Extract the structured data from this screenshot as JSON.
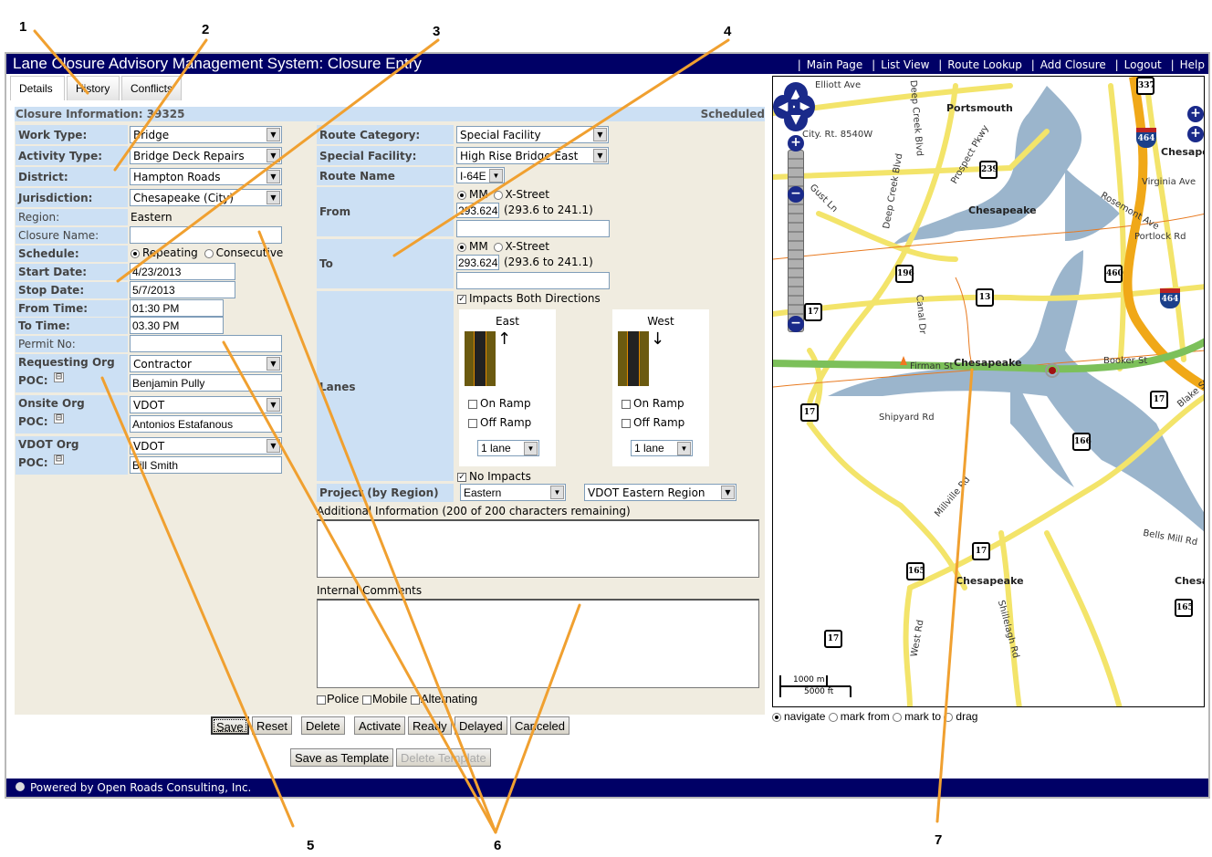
{
  "app": {
    "title": "Lane Closure Advisory Management System: Closure Entry",
    "nav": [
      "Main Page",
      "List View",
      "Route Lookup",
      "Add Closure",
      "Logout",
      "Help"
    ]
  },
  "tabs": [
    {
      "label": "Details",
      "active": true
    },
    {
      "label": "History",
      "active": false
    },
    {
      "label": "Conflicts",
      "active": false
    }
  ],
  "info": {
    "label": "Closure Information: 39325",
    "status": "Scheduled"
  },
  "left_form": {
    "work_type": {
      "label": "Work Type:",
      "value": "Bridge"
    },
    "activity_type": {
      "label": "Activity Type:",
      "value": "Bridge Deck Repairs"
    },
    "district": {
      "label": "District:",
      "value": "Hampton Roads"
    },
    "jurisdiction": {
      "label": "Jurisdiction:",
      "value": "Chesapeake (City)"
    },
    "region": {
      "label": "Region:",
      "value": "Eastern"
    },
    "closure_name": {
      "label": "Closure Name:",
      "value": ""
    },
    "schedule": {
      "label": "Schedule:",
      "options": [
        "Repeating",
        "Consecutive"
      ],
      "selected": "Repeating"
    },
    "start_date": {
      "label": "Start Date:",
      "value": "4/23/2013"
    },
    "stop_date": {
      "label": "Stop Date:",
      "value": "5/7/2013"
    },
    "from_time": {
      "label": "From Time:",
      "value": "01:30 PM"
    },
    "to_time": {
      "label": "To Time:",
      "value": "03.30 PM"
    },
    "permit_no": {
      "label": "Permit No:",
      "value": ""
    },
    "requesting_org": {
      "label": "Requesting Org",
      "value": "Contractor",
      "poc_label": "POC:",
      "poc": "Benjamin Pully"
    },
    "onsite_org": {
      "label": "Onsite Org",
      "value": "VDOT",
      "poc_label": "POC:",
      "poc": "Antonios Estafanous"
    },
    "vdot_org": {
      "label": "VDOT Org",
      "value": "VDOT",
      "poc_label": "POC:",
      "poc": "Bill Smith"
    },
    "collapse_glyph": "⊟"
  },
  "right_form": {
    "route_category": {
      "label": "Route Category:",
      "value": "Special Facility"
    },
    "special_facility": {
      "label": "Special Facility:",
      "value": "High Rise Bridge East"
    },
    "route_name": {
      "label": "Route Name",
      "value": "I-64E"
    },
    "from": {
      "label": "From",
      "options": [
        "MM",
        "X-Street"
      ],
      "selected": "MM",
      "value": "293.624",
      "range": "(293.6 to 241.1)",
      "extra": ""
    },
    "to": {
      "label": "To",
      "options": [
        "MM",
        "X-Street"
      ],
      "selected": "MM",
      "value": "293.624",
      "range": "(293.6 to 241.1)",
      "extra": ""
    },
    "lanes": {
      "label": "Lanes",
      "impacts_both": {
        "label": "Impacts Both Directions",
        "checked": true
      },
      "east": {
        "label": "East",
        "arrow": "↑",
        "on_ramp": "On Ramp",
        "off_ramp": "Off Ramp",
        "lanes": "1 lane"
      },
      "west": {
        "label": "West",
        "arrow": "↓",
        "on_ramp": "On Ramp",
        "off_ramp": "Off Ramp",
        "lanes": "1 lane"
      },
      "no_impacts": {
        "label": "No Impacts",
        "checked": true
      }
    },
    "project": {
      "label": "Project (by Region)",
      "region": "Eastern",
      "org": "VDOT Eastern Region"
    },
    "additional_info": {
      "label": "Additional Information (200 of 200 characters remaining)",
      "value": ""
    },
    "internal_comments": {
      "label": "Internal Comments",
      "value": ""
    },
    "flags": [
      "Police",
      "Mobile",
      "Alternating"
    ]
  },
  "buttons": {
    "row1": [
      "Save",
      "Reset",
      "Delete",
      "Activate",
      "Ready",
      "Delayed",
      "Canceled"
    ],
    "save_template": "Save as Template",
    "delete_template": "Delete Template"
  },
  "footer": {
    "text": "Powered by Open Roads Consulting, Inc."
  },
  "map": {
    "labels": [
      {
        "text": "Elliott Ave"
      },
      {
        "text": "City. Rt. 8540W"
      },
      {
        "text": "Deep Creek Blvd"
      },
      {
        "text": "Deep Creek Blvd"
      },
      {
        "text": "Prospect Pkwy"
      },
      {
        "text": "Gust Ln"
      },
      {
        "text": "Canal Dr"
      },
      {
        "text": "Virginia Ave"
      },
      {
        "text": "Rosemont Ave"
      },
      {
        "text": "Portlock Rd"
      },
      {
        "text": "Firman St"
      },
      {
        "text": "Booker St"
      },
      {
        "text": "Blake St"
      },
      {
        "text": "Shipyard Rd"
      },
      {
        "text": "Millville Rd"
      },
      {
        "text": "Bells Mill Rd"
      },
      {
        "text": "West Rd"
      },
      {
        "text": "Shillelagh Rd"
      }
    ],
    "cities": [
      "Portsmouth",
      "Chesapeake",
      "Chesapeake",
      "Chesapeake",
      "Chesapeake",
      "Chesapeake"
    ],
    "shields": [
      "337",
      "239",
      "196",
      "13",
      "17",
      "460",
      "17",
      "17",
      "166",
      "17",
      "165",
      "17",
      "165"
    ],
    "interstate": "464",
    "scale": {
      "metric": "1000 m",
      "imperial": "5000 ft"
    },
    "modes": [
      "navigate",
      "mark from",
      "mark to",
      "drag"
    ],
    "selected_mode": "navigate"
  },
  "annotations": [
    "1",
    "2",
    "3",
    "4",
    "5",
    "6",
    "7"
  ]
}
